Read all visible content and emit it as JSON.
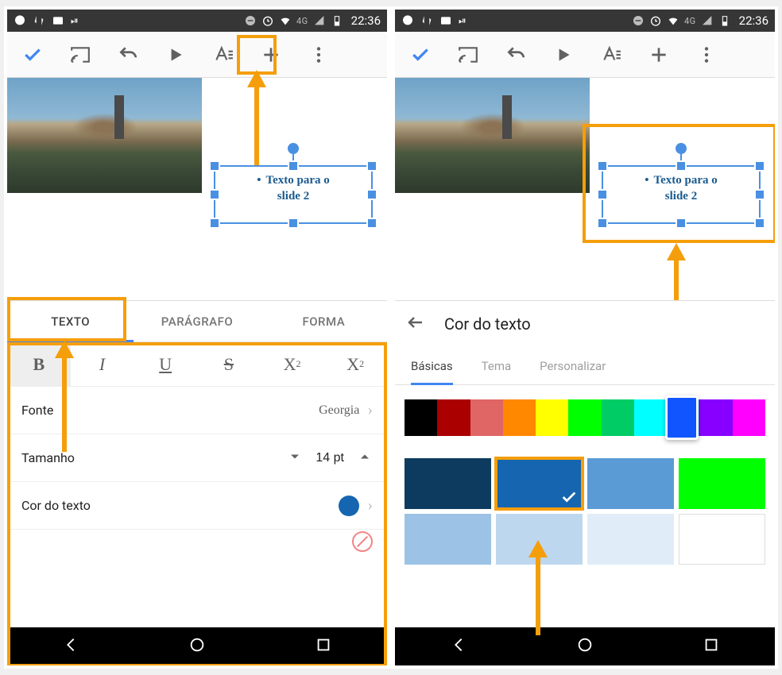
{
  "status": {
    "time": "22:36",
    "network": "4G"
  },
  "toolbar": {
    "confirm": "confirm",
    "cast": "cast",
    "undo": "undo",
    "play": "play",
    "textformat": "text-format",
    "add": "add",
    "more": "more"
  },
  "slide": {
    "textbox_line1": "Texto para o",
    "textbox_line2": "slide 2"
  },
  "panel1": {
    "tabs": {
      "text": "TEXTO",
      "paragraph": "PARÁGRAFO",
      "shape": "FORMA"
    },
    "format": {
      "bold": "B",
      "italic": "I",
      "underline": "U",
      "strike": "S",
      "super": "X",
      "super_exp": "2",
      "sub": "X",
      "sub_exp": "2"
    },
    "rows": {
      "font_label": "Fonte",
      "font_value": "Georgia",
      "size_label": "Tamanho",
      "size_value": "14 pt",
      "color_label": "Cor do texto"
    }
  },
  "panel2": {
    "title": "Cor do texto",
    "tabs": {
      "basic": "Básicas",
      "theme": "Tema",
      "custom": "Personalizar"
    },
    "strip": [
      "#000000",
      "#aa0000",
      "#e06666",
      "#ff8800",
      "#ffff00",
      "#00ff00",
      "#00cc66",
      "#00ffff",
      "#1155ff",
      "#8800ff",
      "#ff00ff"
    ],
    "swatches_row1": [
      "#0d3b5f",
      "#1565b0",
      "#5b9bd5",
      "#00ff00"
    ],
    "swatches_row2": [
      "#9cc3e6",
      "#bdd7ee",
      "#e0ecf7",
      "#ffffff"
    ],
    "selected_index": 1
  },
  "nav": {
    "back": "back",
    "home": "home",
    "recent": "recent"
  }
}
